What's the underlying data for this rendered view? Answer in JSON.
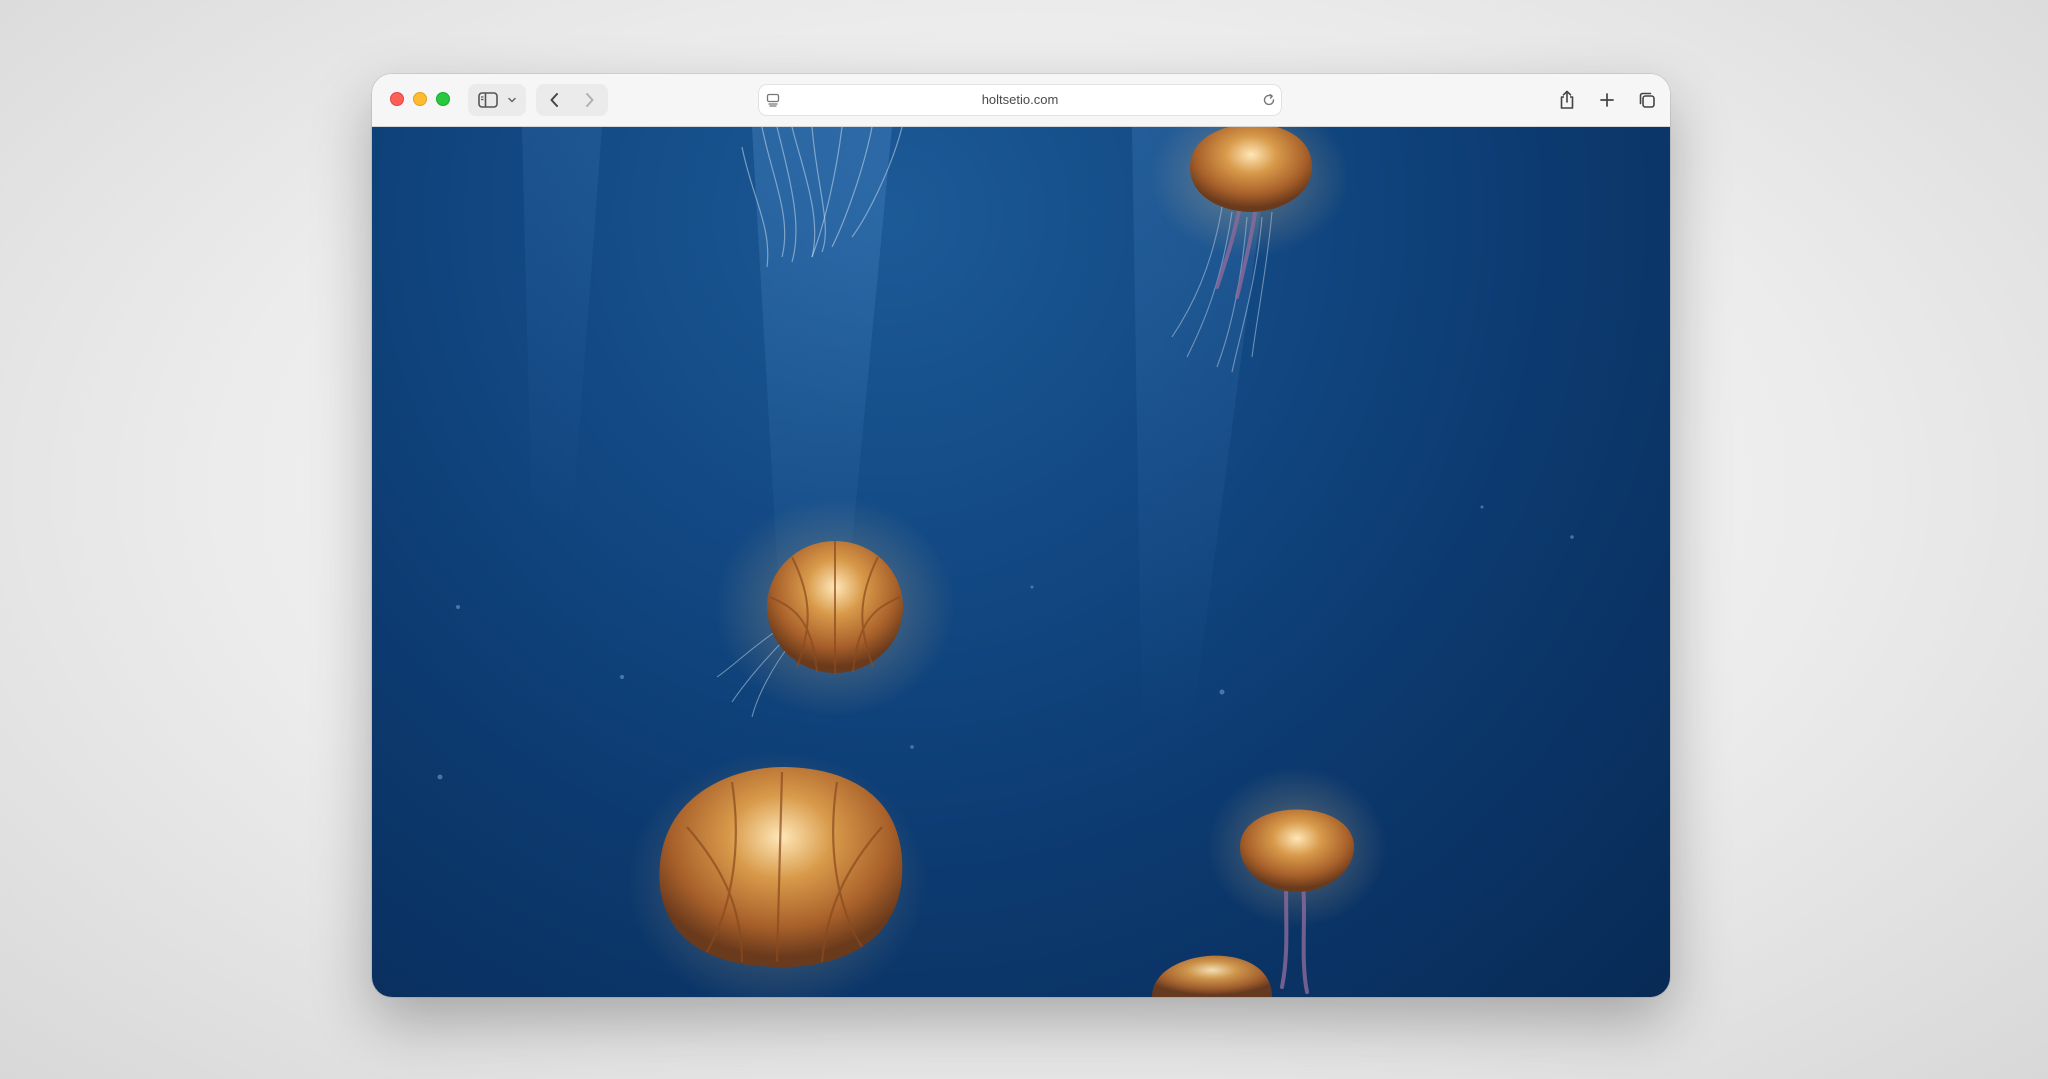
{
  "browser": {
    "url": "holtsetio.com"
  },
  "toolbar": {
    "icons": {
      "close": "close-traffic-light",
      "minimize": "minimize-traffic-light",
      "maximize": "maximize-traffic-light",
      "sidebar": "sidebar-icon",
      "sidebar_menu": "chevron-down-icon",
      "back": "back-arrow-icon",
      "forward": "forward-arrow-icon",
      "page_settings": "page-settings-icon",
      "reload": "reload-icon",
      "share": "share-icon",
      "new_tab": "plus-icon",
      "tab_overview": "tabs-overview-icon"
    }
  },
  "colors": {
    "close": "#ff5f57",
    "minimize": "#febc2e",
    "maximize": "#28c840",
    "ocean_top": "#1c5a97",
    "ocean_bottom": "#082a55",
    "jellyfish": "#c98a3c"
  }
}
